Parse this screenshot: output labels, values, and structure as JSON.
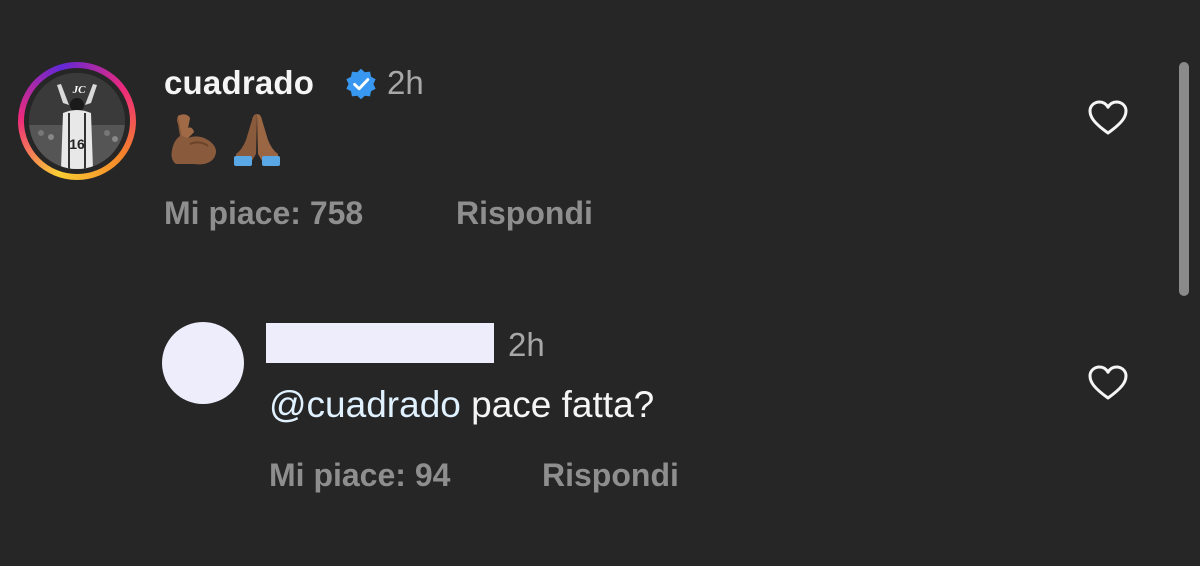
{
  "comment": {
    "username": "cuadrado",
    "verified_icon": "verified-badge-icon",
    "time": "2h",
    "content_emojis": [
      "flexed-biceps-emoji",
      "folded-hands-emoji"
    ],
    "likes_label": "Mi piace: 758",
    "reply_label": "Rispondi",
    "avatar_icon": "profile-photo"
  },
  "reply": {
    "username": "",
    "time": "2h",
    "mention": "@cuadrado",
    "text": "pace fatta?",
    "likes_label": "Mi piace: 94",
    "reply_label": "Rispondi"
  },
  "colors": {
    "background": "#262626",
    "primary_text": "#f5f5f5",
    "secondary_text": "#8e8e8e",
    "verified_blue": "#3897f0",
    "mention": "#e0f1ff"
  }
}
